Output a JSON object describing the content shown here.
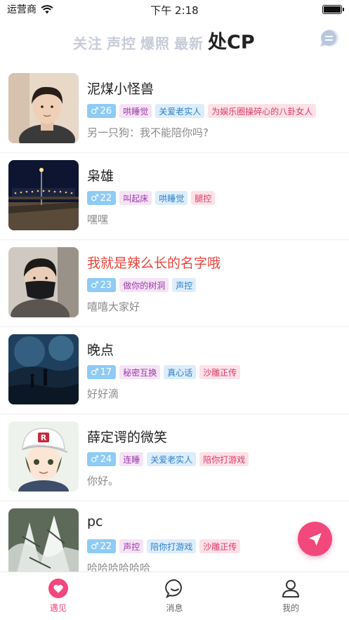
{
  "status_bar": {
    "carrier": "运营商",
    "time": "下午 2:18"
  },
  "tabs": [
    {
      "label": "关注"
    },
    {
      "label": "声控"
    },
    {
      "label": "爆照"
    },
    {
      "label": "最新"
    },
    {
      "label": "处CP"
    }
  ],
  "active_tab": "处CP",
  "users": [
    {
      "name": "泥煤小怪兽",
      "age": "26",
      "tags": [
        "哄睡觉",
        "关爱老实人",
        "为娱乐圈操碎心的八卦女人"
      ],
      "signature": "另一只狗：我不能陪你吗?",
      "name_color": "#222222"
    },
    {
      "name": "枭雄",
      "age": "22",
      "tags": [
        "叫起床",
        "哄睡觉",
        "腿控"
      ],
      "signature": "嘿嘿",
      "name_color": "#222222"
    },
    {
      "name": "我就是辣么长的名字哦",
      "age": "23",
      "tags": [
        "做你的树洞",
        "声控"
      ],
      "signature": "嘻嘻大家好",
      "name_color": "#e8443a"
    },
    {
      "name": "晚点",
      "age": "17",
      "tags": [
        "秘密互换",
        "真心话",
        "沙雕正传"
      ],
      "signature": "好好滴",
      "name_color": "#222222"
    },
    {
      "name": "薛定谔的微笑",
      "age": "24",
      "tags": [
        "连睡",
        "关爱老实人",
        "陪你打游戏"
      ],
      "signature": "你好。",
      "name_color": "#222222"
    },
    {
      "name": "pc",
      "age": "22",
      "tags": [
        "声控",
        "陪你打游戏",
        "沙雕正传"
      ],
      "signature": "哈哈哈哈哈哈",
      "name_color": "#222222"
    }
  ],
  "bottom_nav": [
    {
      "label": "遇见",
      "icon": "heart-icon",
      "active": true
    },
    {
      "label": "消息",
      "icon": "chat-bubble-icon",
      "active": false
    },
    {
      "label": "我的",
      "icon": "profile-icon",
      "active": false
    }
  ],
  "colors": {
    "accent": "#f2487d",
    "age_badge": "#8ecbf5",
    "tab_inactive": "#c7ccd8"
  }
}
